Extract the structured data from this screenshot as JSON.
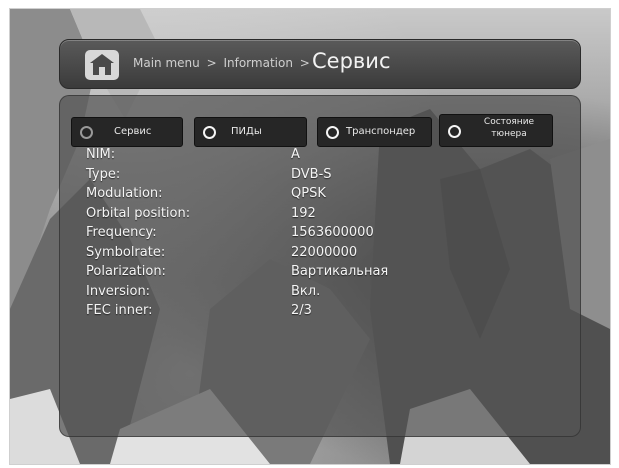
{
  "header": {
    "breadcrumb_main": "Main menu",
    "breadcrumb_sep": ">",
    "breadcrumb_info": "Information",
    "current": "Сервис"
  },
  "tabs": [
    {
      "label": "Сервис"
    },
    {
      "label": "ПИДы"
    },
    {
      "label": "Транспондер"
    },
    {
      "label_line1": "Состояние",
      "label_line2": "тюнера"
    }
  ],
  "info": [
    {
      "key": "NIM:",
      "value": "A"
    },
    {
      "key": "Type:",
      "value": "DVB-S"
    },
    {
      "key": "Modulation:",
      "value": "QPSK"
    },
    {
      "key": "Orbital position:",
      "value": "192"
    },
    {
      "key": "Frequency:",
      "value": "1563600000"
    },
    {
      "key": "Symbolrate:",
      "value": "22000000"
    },
    {
      "key": "Polarization:",
      "value": "Вартикальная"
    },
    {
      "key": "Inversion:",
      "value": "Вкл."
    },
    {
      "key": "FEC inner:",
      "value": "2/3"
    }
  ],
  "colors": {
    "header_bg": "#3b3b3b",
    "panel_bg": "#555555",
    "tab_bg": "#262626",
    "text": "#f5f5f5"
  },
  "icons": {
    "home": "home-icon",
    "tab_indicator": "ring-indicator-icon"
  }
}
